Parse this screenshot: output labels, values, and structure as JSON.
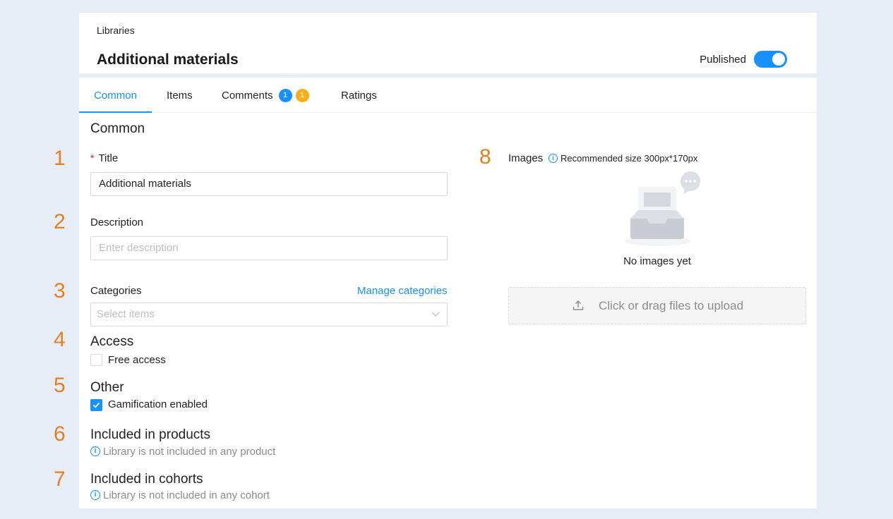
{
  "header": {
    "breadcrumb": "Libraries",
    "title": "Additional materials",
    "published_label": "Published",
    "published": true
  },
  "tabs": [
    {
      "label": "Common",
      "active": true
    },
    {
      "label": "Items"
    },
    {
      "label": "Comments",
      "badges": [
        "1",
        "1"
      ]
    },
    {
      "label": "Ratings"
    }
  ],
  "form": {
    "section_title": "Common",
    "numbers": [
      "1",
      "2",
      "3",
      "4",
      "5",
      "6",
      "7",
      "8"
    ],
    "title_label": "Title",
    "title_required_mark": "*",
    "title_value": "Additional materials",
    "description_label": "Description",
    "description_placeholder": "Enter description",
    "categories_label": "Categories",
    "manage_categories": "Manage categories",
    "categories_placeholder": "Select items",
    "access_title": "Access",
    "free_access_label": "Free access",
    "free_access_checked": false,
    "other_title": "Other",
    "gamification_label": "Gamification enabled",
    "gamification_checked": true,
    "products_title": "Included in products",
    "products_info": "Library is not included in any product",
    "cohorts_title": "Included in cohorts",
    "cohorts_info": "Library is not included in any cohort"
  },
  "images": {
    "label": "Images",
    "hint": "Recommended size 300px*170px",
    "empty_text": "No images yet",
    "upload_text": "Click or drag files to upload"
  },
  "colors": {
    "accent": "#1890ff",
    "badge_orange": "#faad14",
    "numbers": "#e67e22",
    "required": "#f5222d"
  },
  "icons": [
    "toggle-switch",
    "info-icon",
    "chevron-down-icon",
    "check-icon",
    "upload-icon",
    "empty-inbox-illustration"
  ]
}
